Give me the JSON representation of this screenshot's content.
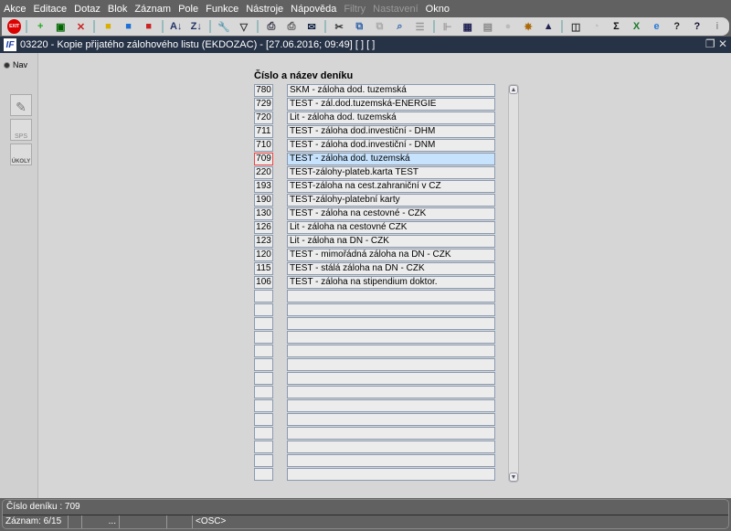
{
  "menu": [
    "Akce",
    "Editace",
    "Dotaz",
    "Blok",
    "Záznam",
    "Pole",
    "Funkce",
    "Nástroje",
    "Nápověda",
    "Filtry",
    "Nastavení",
    "Okno"
  ],
  "menu_disabled": [
    "Filtry",
    "Nastavení"
  ],
  "toolbar": [
    "exit-icon",
    "new-record-icon",
    "save-record-icon",
    "delete-record-icon",
    "lock-yellow-icon",
    "lock-blue-icon",
    "lock-red-icon",
    "sort-asc-icon",
    "sort-desc-icon",
    "wrench-icon",
    "filter-icon",
    "print-icon",
    "print-preview-icon",
    "mail-icon",
    "cut-icon",
    "copy-icon",
    "paste-icon",
    "search-icon",
    "list-icon",
    "tree-icon",
    "calendar-icon",
    "document-icon",
    "globe-icon",
    "wheel-icon",
    "triangle-icon",
    "chart-icon",
    "clock-icon",
    "sum-icon",
    "excel-icon",
    "ie-icon",
    "help-icon",
    "help-topic-icon",
    "info-icon"
  ],
  "title": {
    "app_logo": "IF",
    "text": "03220 - Kopie přijatého zálohového listu (EKDOZAC) - [27.06.2016; 09:49]  [ ]  [ ]"
  },
  "left": {
    "nav_label": "Nav",
    "btn_sps": "SPS",
    "btn_ukoly": "ÚKOLY"
  },
  "form": {
    "heading": "Číslo a název deníku",
    "rows": [
      {
        "num": "780",
        "name": "SKM - záloha dod. tuzemská"
      },
      {
        "num": "729",
        "name": "TEST - zál.dod.tuzemská-ENERGIE"
      },
      {
        "num": "720",
        "name": "Lit - záloha dod. tuzemská"
      },
      {
        "num": "711",
        "name": "TEST - záloha dod.investiční - DHM"
      },
      {
        "num": "710",
        "name": "TEST - záloha dod.investiční - DNM"
      },
      {
        "num": "709",
        "name": "TEST - záloha dod. tuzemská"
      },
      {
        "num": "220",
        "name": "TEST-zálohy-plateb.karta TEST"
      },
      {
        "num": "193",
        "name": "TEST-záloha na cest.zahraniční v CZ"
      },
      {
        "num": "190",
        "name": "TEST-zálohy-platební karty"
      },
      {
        "num": "130",
        "name": "TEST - záloha na cestovné - CZK"
      },
      {
        "num": "126",
        "name": "Lit - záloha na cestovné CZK"
      },
      {
        "num": "123",
        "name": "Lit - záloha na DN - CZK"
      },
      {
        "num": "120",
        "name": "TEST - mimořádná záloha na DN - CZK"
      },
      {
        "num": "115",
        "name": "TEST - stálá záloha na DN - CZK"
      },
      {
        "num": "106",
        "name": "TEST - záloha na stipendium doktor."
      }
    ],
    "selected_index": 5,
    "empty_rows": 14
  },
  "status": {
    "field": "Číslo deníku : 709",
    "record": "Záznam: 6/15",
    "dots": "...",
    "mode": "<OSC>"
  }
}
